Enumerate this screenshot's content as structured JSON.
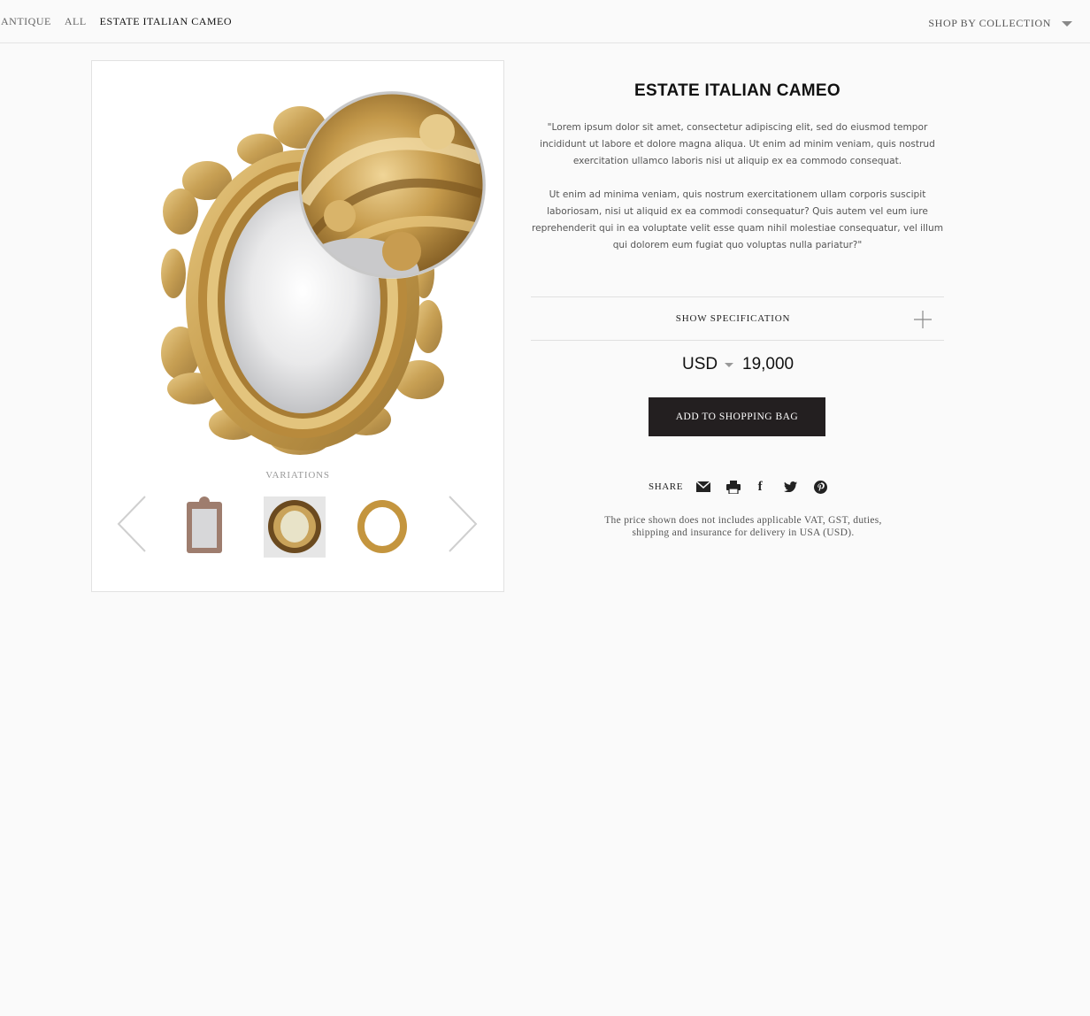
{
  "breadcrumb": {
    "items": [
      "ANTIQUE",
      "ALL",
      "ESTATE ITALIAN CAMEO"
    ]
  },
  "nav": {
    "shop_by_collection": "SHOP BY COLLECTION"
  },
  "gallery": {
    "variations_label": "VARIATIONS",
    "thumbnails": [
      "rectangular-ornate-mirror",
      "oval-baroque-mirror",
      "oval-gilt-mirror"
    ]
  },
  "product": {
    "title": "ESTATE ITALIAN CAMEO",
    "description_1": "\"Lorem ipsum dolor sit amet, consectetur adipiscing elit, sed do eiusmod tempor incididunt ut labore et dolore magna aliqua. Ut enim ad minim veniam, quis nostrud exercitation ullamco laboris nisi ut aliquip ex ea commodo consequat.",
    "description_2": "Ut enim ad minima veniam, quis nostrum exercitationem ullam corporis suscipit laboriosam, nisi ut aliquid ex ea commodi consequatur? Quis autem vel eum iure reprehenderit qui in ea voluptate velit esse quam nihil molestiae consequatur, vel illum qui dolorem eum fugiat quo voluptas nulla pariatur?\"",
    "spec_label": "SHOW SPECIFICATION",
    "currency": "USD",
    "price": "19,000",
    "add_button": "ADD TO SHOPPING BAG",
    "share_label": "SHARE",
    "disclaimer_line1": "The price shown does not includes applicable VAT, GST, duties,",
    "disclaimer_line2": "shipping and insurance for delivery in USA (USD)."
  },
  "colors": {
    "button_bg": "#231f20",
    "gold": "#c9a255",
    "background": "#fafafa"
  }
}
